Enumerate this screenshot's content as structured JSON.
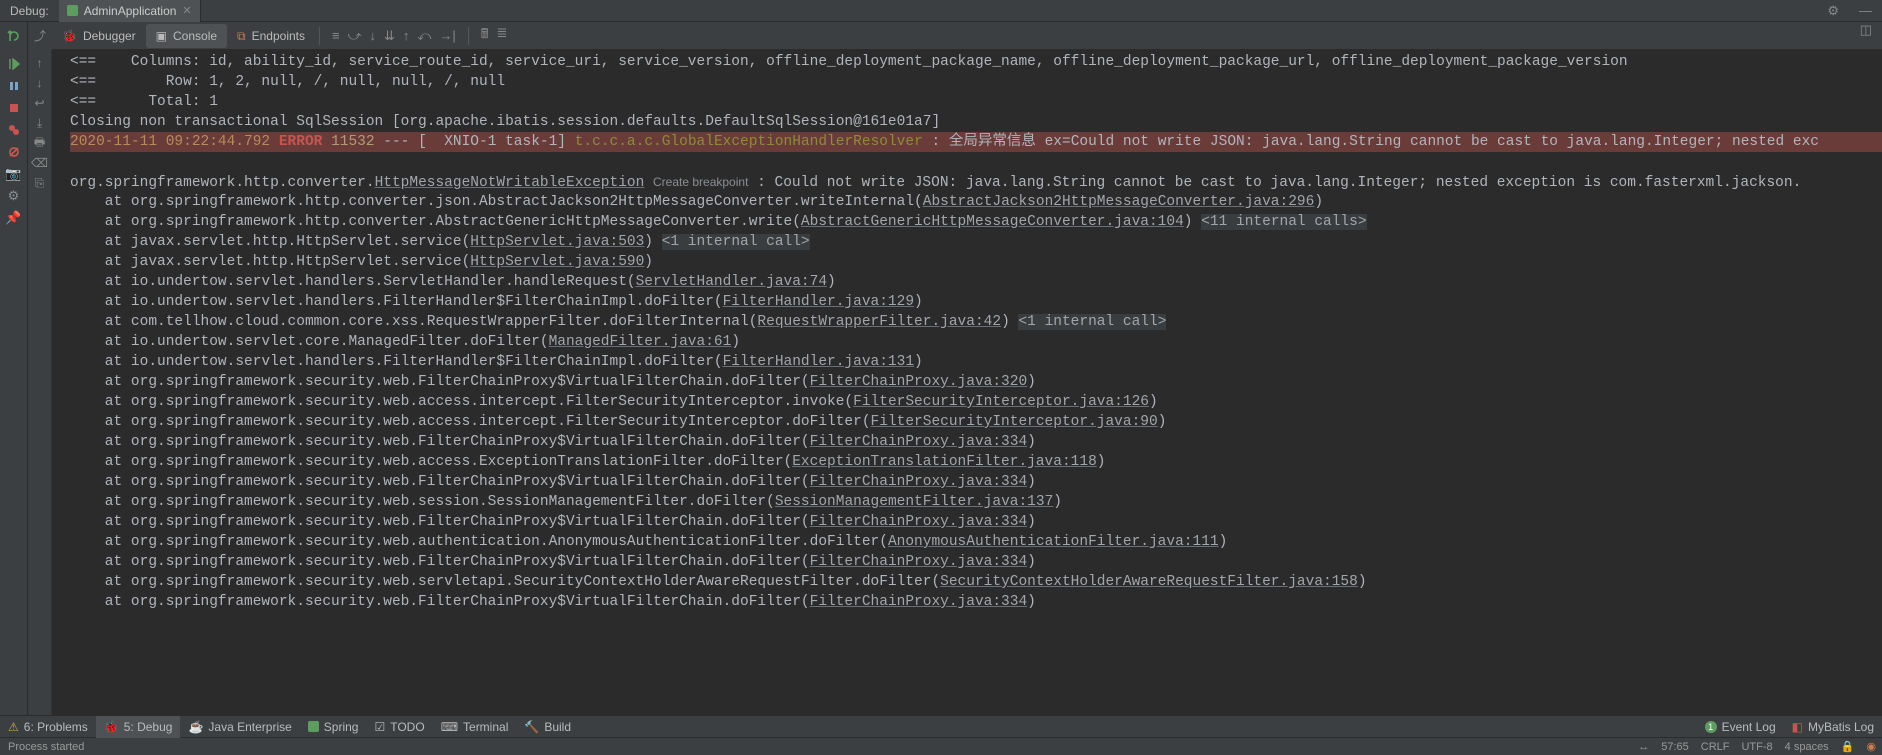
{
  "tabstrip": {
    "label": "Debug:",
    "tab_name": "AdminApplication"
  },
  "toolbar": {
    "debugger": "Debugger",
    "console": "Console",
    "endpoints": "Endpoints"
  },
  "console": {
    "l1_a": "<==    Columns: id, ability_id, service_route_id, service_uri, service_version, offline_deployment_package_name, offline_deployment_package_url, offline_deployment_package_version",
    "l2_a": "<==        Row: 1, 2, null, /, null, null, /, null",
    "l3_a": "<==      Total: 1",
    "l4_a": "Closing non transactional SqlSession [org.apache.ibatis.session.defaults.DefaultSqlSession@161e01a7]",
    "err_ts": "2020-11-11 09:22:44.792",
    "err_lvl": "ERROR",
    "err_code": "11532",
    "err_sep": " --- [  XNIO-1 task-1] ",
    "err_cls": "t.c.c.a.c.GlobalExceptionHandlerResolver",
    "err_msg": " : 全局异常信息 ex=Could not write JSON: java.lang.String cannot be cast to java.lang.Integer; nested exc",
    "ex_head_a": "org.springframework.http.converter.",
    "ex_head_link": "HttpMessageNotWritableException",
    "ex_head_cbp": "Create breakpoint",
    "ex_head_b": " : Could not write JSON: java.lang.String cannot be cast to java.lang.Integer; nested exception is com.fasterxml.jackson.",
    "st": [
      {
        "a": "    at org.springframework.http.converter.json.AbstractJackson2HttpMessageConverter.writeInternal(",
        "link": "AbstractJackson2HttpMessageConverter.java:296",
        "b": ")",
        "tail": ""
      },
      {
        "a": "    at org.springframework.http.converter.AbstractGenericHttpMessageConverter.write(",
        "link": "AbstractGenericHttpMessageConverter.java:104",
        "b": ") ",
        "tail": "<11 internal calls>"
      },
      {
        "a": "    at javax.servlet.http.HttpServlet.service(",
        "link": "HttpServlet.java:503",
        "b": ") ",
        "tail": "<1 internal call>"
      },
      {
        "a": "    at javax.servlet.http.HttpServlet.service(",
        "link": "HttpServlet.java:590",
        "b": ")",
        "tail": ""
      },
      {
        "a": "    at io.undertow.servlet.handlers.ServletHandler.handleRequest(",
        "link": "ServletHandler.java:74",
        "b": ")",
        "tail": ""
      },
      {
        "a": "    at io.undertow.servlet.handlers.FilterHandler$FilterChainImpl.doFilter(",
        "link": "FilterHandler.java:129",
        "b": ")",
        "tail": ""
      },
      {
        "a": "    at com.tellhow.cloud.common.core.xss.RequestWrapperFilter.doFilterInternal(",
        "link": "RequestWrapperFilter.java:42",
        "b": ") ",
        "tail": "<1 internal call>"
      },
      {
        "a": "    at io.undertow.servlet.core.ManagedFilter.doFilter(",
        "link": "ManagedFilter.java:61",
        "b": ")",
        "tail": ""
      },
      {
        "a": "    at io.undertow.servlet.handlers.FilterHandler$FilterChainImpl.doFilter(",
        "link": "FilterHandler.java:131",
        "b": ")",
        "tail": ""
      },
      {
        "a": "    at org.springframework.security.web.FilterChainProxy$VirtualFilterChain.doFilter(",
        "link": "FilterChainProxy.java:320",
        "b": ")",
        "tail": ""
      },
      {
        "a": "    at org.springframework.security.web.access.intercept.FilterSecurityInterceptor.invoke(",
        "link": "FilterSecurityInterceptor.java:126",
        "b": ")",
        "tail": ""
      },
      {
        "a": "    at org.springframework.security.web.access.intercept.FilterSecurityInterceptor.doFilter(",
        "link": "FilterSecurityInterceptor.java:90",
        "b": ")",
        "tail": ""
      },
      {
        "a": "    at org.springframework.security.web.FilterChainProxy$VirtualFilterChain.doFilter(",
        "link": "FilterChainProxy.java:334",
        "b": ")",
        "tail": ""
      },
      {
        "a": "    at org.springframework.security.web.access.ExceptionTranslationFilter.doFilter(",
        "link": "ExceptionTranslationFilter.java:118",
        "b": ")",
        "tail": ""
      },
      {
        "a": "    at org.springframework.security.web.FilterChainProxy$VirtualFilterChain.doFilter(",
        "link": "FilterChainProxy.java:334",
        "b": ")",
        "tail": ""
      },
      {
        "a": "    at org.springframework.security.web.session.SessionManagementFilter.doFilter(",
        "link": "SessionManagementFilter.java:137",
        "b": ")",
        "tail": ""
      },
      {
        "a": "    at org.springframework.security.web.FilterChainProxy$VirtualFilterChain.doFilter(",
        "link": "FilterChainProxy.java:334",
        "b": ")",
        "tail": ""
      },
      {
        "a": "    at org.springframework.security.web.authentication.AnonymousAuthenticationFilter.doFilter(",
        "link": "AnonymousAuthenticationFilter.java:111",
        "b": ")",
        "tail": ""
      },
      {
        "a": "    at org.springframework.security.web.FilterChainProxy$VirtualFilterChain.doFilter(",
        "link": "FilterChainProxy.java:334",
        "b": ")",
        "tail": ""
      },
      {
        "a": "    at org.springframework.security.web.servletapi.SecurityContextHolderAwareRequestFilter.doFilter(",
        "link": "SecurityContextHolderAwareRequestFilter.java:158",
        "b": ")",
        "tail": ""
      },
      {
        "a": "    at org.springframework.security.web.FilterChainProxy$VirtualFilterChain.doFilter(",
        "link": "FilterChainProxy.java:334",
        "b": ")",
        "tail": ""
      }
    ]
  },
  "bottom": {
    "problems": "6: Problems",
    "debug": "5: Debug",
    "java_ee": "Java Enterprise",
    "spring": "Spring",
    "todo": "TODO",
    "terminal": "Terminal",
    "build": "Build",
    "event_log": "Event Log",
    "mybatis": "MyBatis Log",
    "badge": "1"
  },
  "status": {
    "left": "Process started",
    "pos": "57:65",
    "eol": "CRLF",
    "enc": "UTF-8",
    "indent": "4 spaces"
  }
}
